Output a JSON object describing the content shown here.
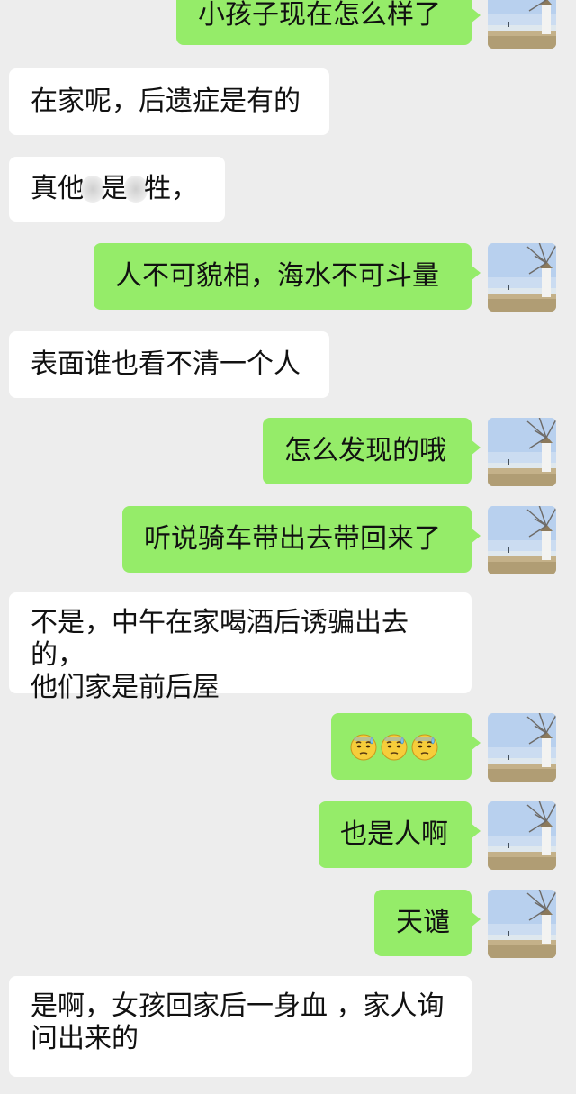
{
  "messages": [
    {
      "id": "m1",
      "side": "out",
      "text": "小孩子现在怎么样了"
    },
    {
      "id": "m2",
      "side": "in",
      "text": "在家呢，后遗症是有的"
    },
    {
      "id": "m3",
      "side": "in",
      "parts": [
        "真他",
        "是",
        "牲，"
      ]
    },
    {
      "id": "m4",
      "side": "out",
      "text": "人不可貌相，海水不可斗量"
    },
    {
      "id": "m5",
      "side": "in",
      "text": "表面谁也看不清一个人"
    },
    {
      "id": "m6",
      "side": "out",
      "text": "怎么发现的哦"
    },
    {
      "id": "m7",
      "side": "out",
      "text": "听说骑车带出去带回来了"
    },
    {
      "id": "m8",
      "side": "in",
      "lines": [
        "不是，中午在家喝酒后诱骗出去的，",
        "他们家是前后屋"
      ]
    },
    {
      "id": "m9",
      "side": "out",
      "emojis": [
        "sweat-face-emoji",
        "sweat-face-emoji",
        "sweat-face-emoji"
      ]
    },
    {
      "id": "m10",
      "side": "out",
      "text": "也是人啊"
    },
    {
      "id": "m11",
      "side": "out",
      "text": "天谴"
    },
    {
      "id": "m12",
      "side": "in",
      "lines": [
        "是啊，女孩回家后一身血 ，家人询",
        "问出来的"
      ]
    }
  ],
  "colors": {
    "background": "#ededed",
    "incoming_bubble": "#ffffff",
    "outgoing_bubble": "#95ec69",
    "text": "#111111"
  },
  "icons": {
    "avatar": "windmill-seaside-avatar",
    "blurred_text": "blurred-censor-mark"
  }
}
